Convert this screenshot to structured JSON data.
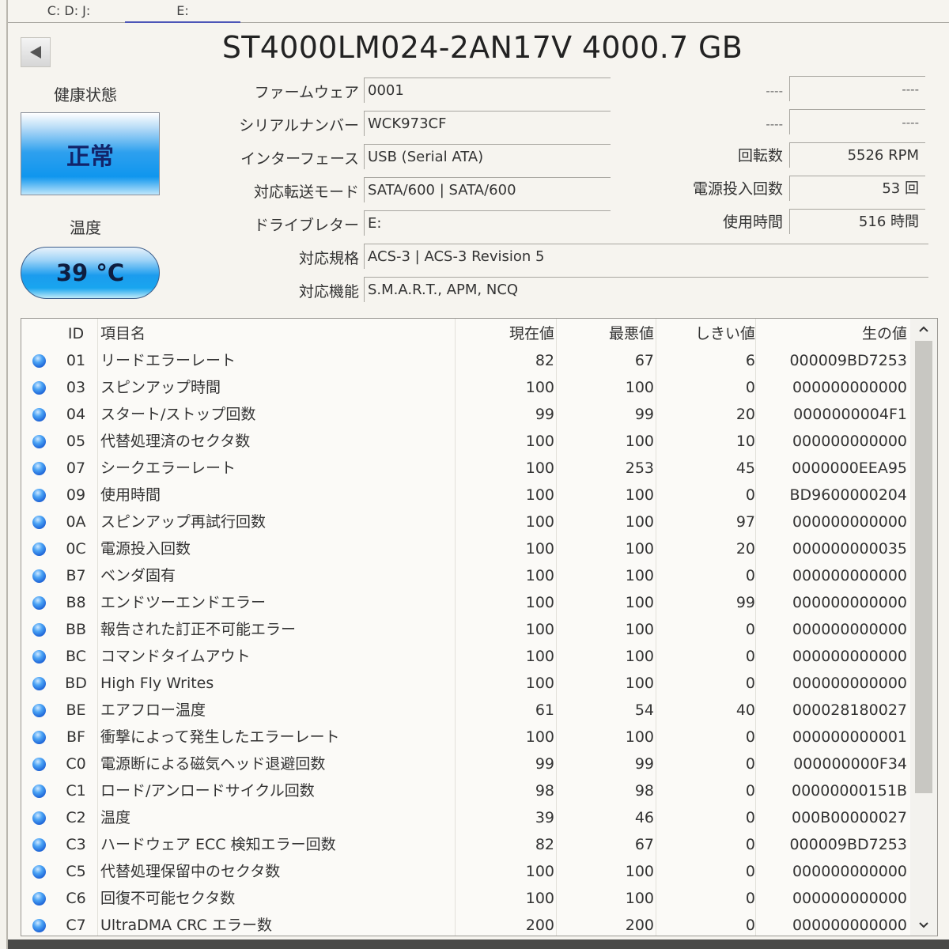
{
  "drive_tabs": [
    {
      "label": "C: D: J:",
      "active": false
    },
    {
      "label": "E:",
      "active": true
    }
  ],
  "title": "ST4000LM024-2AN17V 4000.7 GB",
  "health": {
    "label": "健康状態",
    "status": "正常"
  },
  "temperature": {
    "label": "温度",
    "value": "39 °C"
  },
  "info": {
    "firmware": {
      "label": "ファームウェア",
      "value": "0001"
    },
    "serial": {
      "label": "シリアルナンバー",
      "value": "WCK973CF"
    },
    "interface": {
      "label": "インターフェース",
      "value": "USB (Serial ATA)"
    },
    "transfer_mode": {
      "label": "対応転送モード",
      "value": "SATA/600 | SATA/600"
    },
    "drive_letter": {
      "label": "ドライブレター",
      "value": "E:"
    },
    "standard": {
      "label": "対応規格",
      "value": "ACS-3 | ACS-3 Revision 5"
    },
    "features": {
      "label": "対応機能",
      "value": "S.M.A.R.T., APM, NCQ"
    }
  },
  "right_info": {
    "blank1": {
      "label": "----",
      "value": "----"
    },
    "blank2": {
      "label": "----",
      "value": "----"
    },
    "rotation": {
      "label": "回転数",
      "value": "5526 RPM"
    },
    "power_on_count": {
      "label": "電源投入回数",
      "value": "53 回"
    },
    "power_on_hours": {
      "label": "使用時間",
      "value": "516 時間"
    }
  },
  "smart": {
    "headers": {
      "id": "ID",
      "name": "項目名",
      "current": "現在値",
      "worst": "最悪値",
      "threshold": "しきい値",
      "raw": "生の値"
    },
    "status_color": "#1e63d6",
    "rows": [
      {
        "id": "01",
        "name": "リードエラーレート",
        "current": "82",
        "worst": "67",
        "threshold": "6",
        "raw": "000009BD7253"
      },
      {
        "id": "03",
        "name": "スピンアップ時間",
        "current": "100",
        "worst": "100",
        "threshold": "0",
        "raw": "000000000000"
      },
      {
        "id": "04",
        "name": "スタート/ストップ回数",
        "current": "99",
        "worst": "99",
        "threshold": "20",
        "raw": "0000000004F1"
      },
      {
        "id": "05",
        "name": "代替処理済のセクタ数",
        "current": "100",
        "worst": "100",
        "threshold": "10",
        "raw": "000000000000"
      },
      {
        "id": "07",
        "name": "シークエラーレート",
        "current": "100",
        "worst": "253",
        "threshold": "45",
        "raw": "0000000EEA95"
      },
      {
        "id": "09",
        "name": "使用時間",
        "current": "100",
        "worst": "100",
        "threshold": "0",
        "raw": "BD9600000204"
      },
      {
        "id": "0A",
        "name": "スピンアップ再試行回数",
        "current": "100",
        "worst": "100",
        "threshold": "97",
        "raw": "000000000000"
      },
      {
        "id": "0C",
        "name": "電源投入回数",
        "current": "100",
        "worst": "100",
        "threshold": "20",
        "raw": "000000000035"
      },
      {
        "id": "B7",
        "name": "ベンダ固有",
        "current": "100",
        "worst": "100",
        "threshold": "0",
        "raw": "000000000000"
      },
      {
        "id": "B8",
        "name": "エンドツーエンドエラー",
        "current": "100",
        "worst": "100",
        "threshold": "99",
        "raw": "000000000000"
      },
      {
        "id": "BB",
        "name": "報告された訂正不可能エラー",
        "current": "100",
        "worst": "100",
        "threshold": "0",
        "raw": "000000000000"
      },
      {
        "id": "BC",
        "name": "コマンドタイムアウト",
        "current": "100",
        "worst": "100",
        "threshold": "0",
        "raw": "000000000000"
      },
      {
        "id": "BD",
        "name": "High Fly Writes",
        "current": "100",
        "worst": "100",
        "threshold": "0",
        "raw": "000000000000"
      },
      {
        "id": "BE",
        "name": "エアフロー温度",
        "current": "61",
        "worst": "54",
        "threshold": "40",
        "raw": "000028180027"
      },
      {
        "id": "BF",
        "name": "衝撃によって発生したエラーレート",
        "current": "100",
        "worst": "100",
        "threshold": "0",
        "raw": "000000000001"
      },
      {
        "id": "C0",
        "name": "電源断による磁気ヘッド退避回数",
        "current": "99",
        "worst": "99",
        "threshold": "0",
        "raw": "000000000F34"
      },
      {
        "id": "C1",
        "name": "ロード/アンロードサイクル回数",
        "current": "98",
        "worst": "98",
        "threshold": "0",
        "raw": "00000000151B"
      },
      {
        "id": "C2",
        "name": "温度",
        "current": "39",
        "worst": "46",
        "threshold": "0",
        "raw": "000B00000027"
      },
      {
        "id": "C3",
        "name": "ハードウェア ECC 検知エラー回数",
        "current": "82",
        "worst": "67",
        "threshold": "0",
        "raw": "000009BD7253"
      },
      {
        "id": "C5",
        "name": "代替処理保留中のセクタ数",
        "current": "100",
        "worst": "100",
        "threshold": "0",
        "raw": "000000000000"
      },
      {
        "id": "C6",
        "name": "回復不可能セクタ数",
        "current": "100",
        "worst": "100",
        "threshold": "0",
        "raw": "000000000000"
      },
      {
        "id": "C7",
        "name": "UltraDMA CRC エラー数",
        "current": "200",
        "worst": "200",
        "threshold": "0",
        "raw": "000000000000"
      }
    ]
  },
  "scrollbar": {
    "up_icon": "^",
    "down_icon": "v"
  }
}
